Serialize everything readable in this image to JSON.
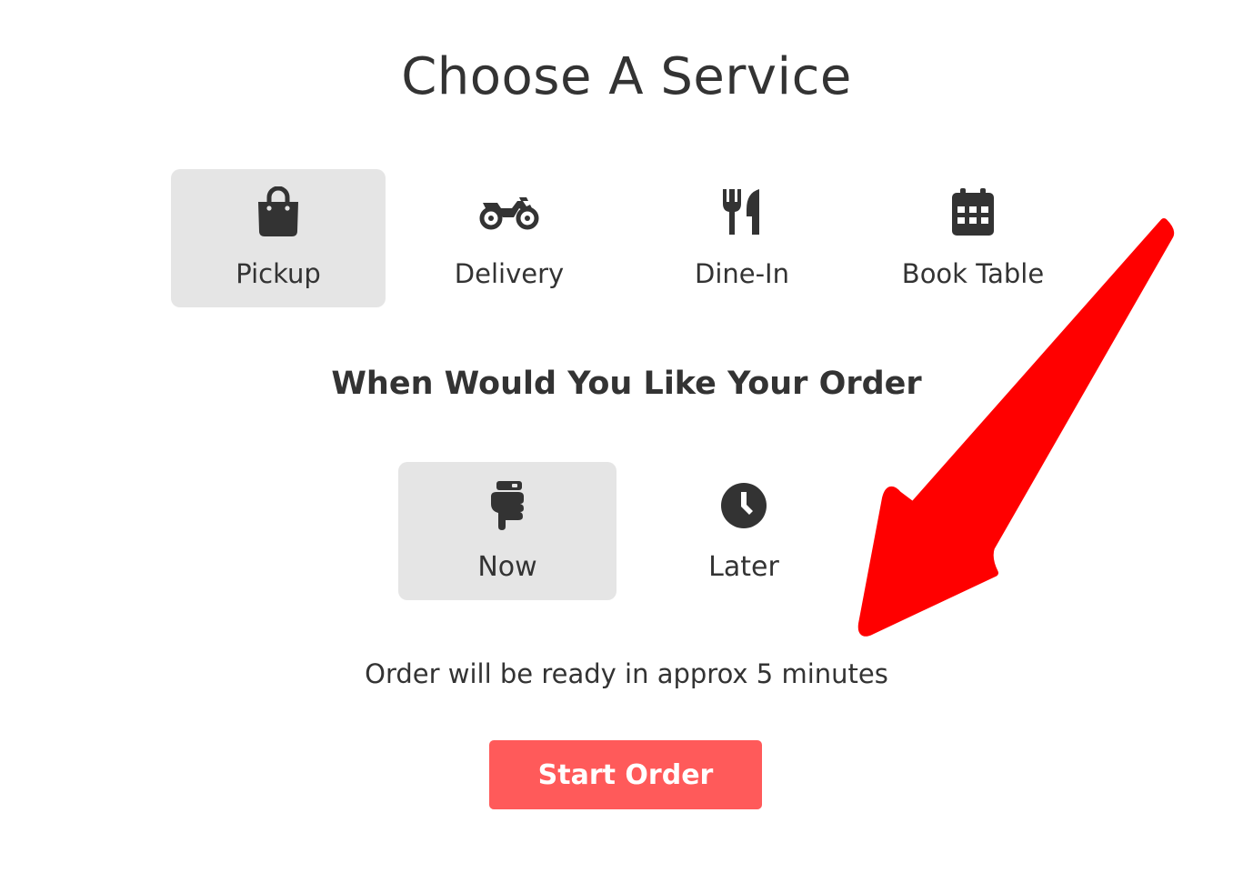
{
  "page": {
    "title": "Choose A Service",
    "subtitle": "When Would You Like Your Order",
    "ready_text": "Order will be ready in approx 5 minutes"
  },
  "services": [
    {
      "label": "Pickup",
      "icon": "shopping-bag-icon",
      "selected": true
    },
    {
      "label": "Delivery",
      "icon": "motorcycle-icon",
      "selected": false
    },
    {
      "label": "Dine-In",
      "icon": "utensils-icon",
      "selected": false
    },
    {
      "label": "Book Table",
      "icon": "calendar-icon",
      "selected": false
    }
  ],
  "times": [
    {
      "label": "Now",
      "icon": "hand-pointing-down-icon",
      "selected": true
    },
    {
      "label": "Later",
      "icon": "clock-icon",
      "selected": false
    }
  ],
  "start_button": {
    "label": "Start Order"
  },
  "colors": {
    "accent": "#ff5a5a",
    "selected_bg": "#e5e5e5",
    "text": "#333333",
    "annotation_arrow": "#ff0000"
  }
}
